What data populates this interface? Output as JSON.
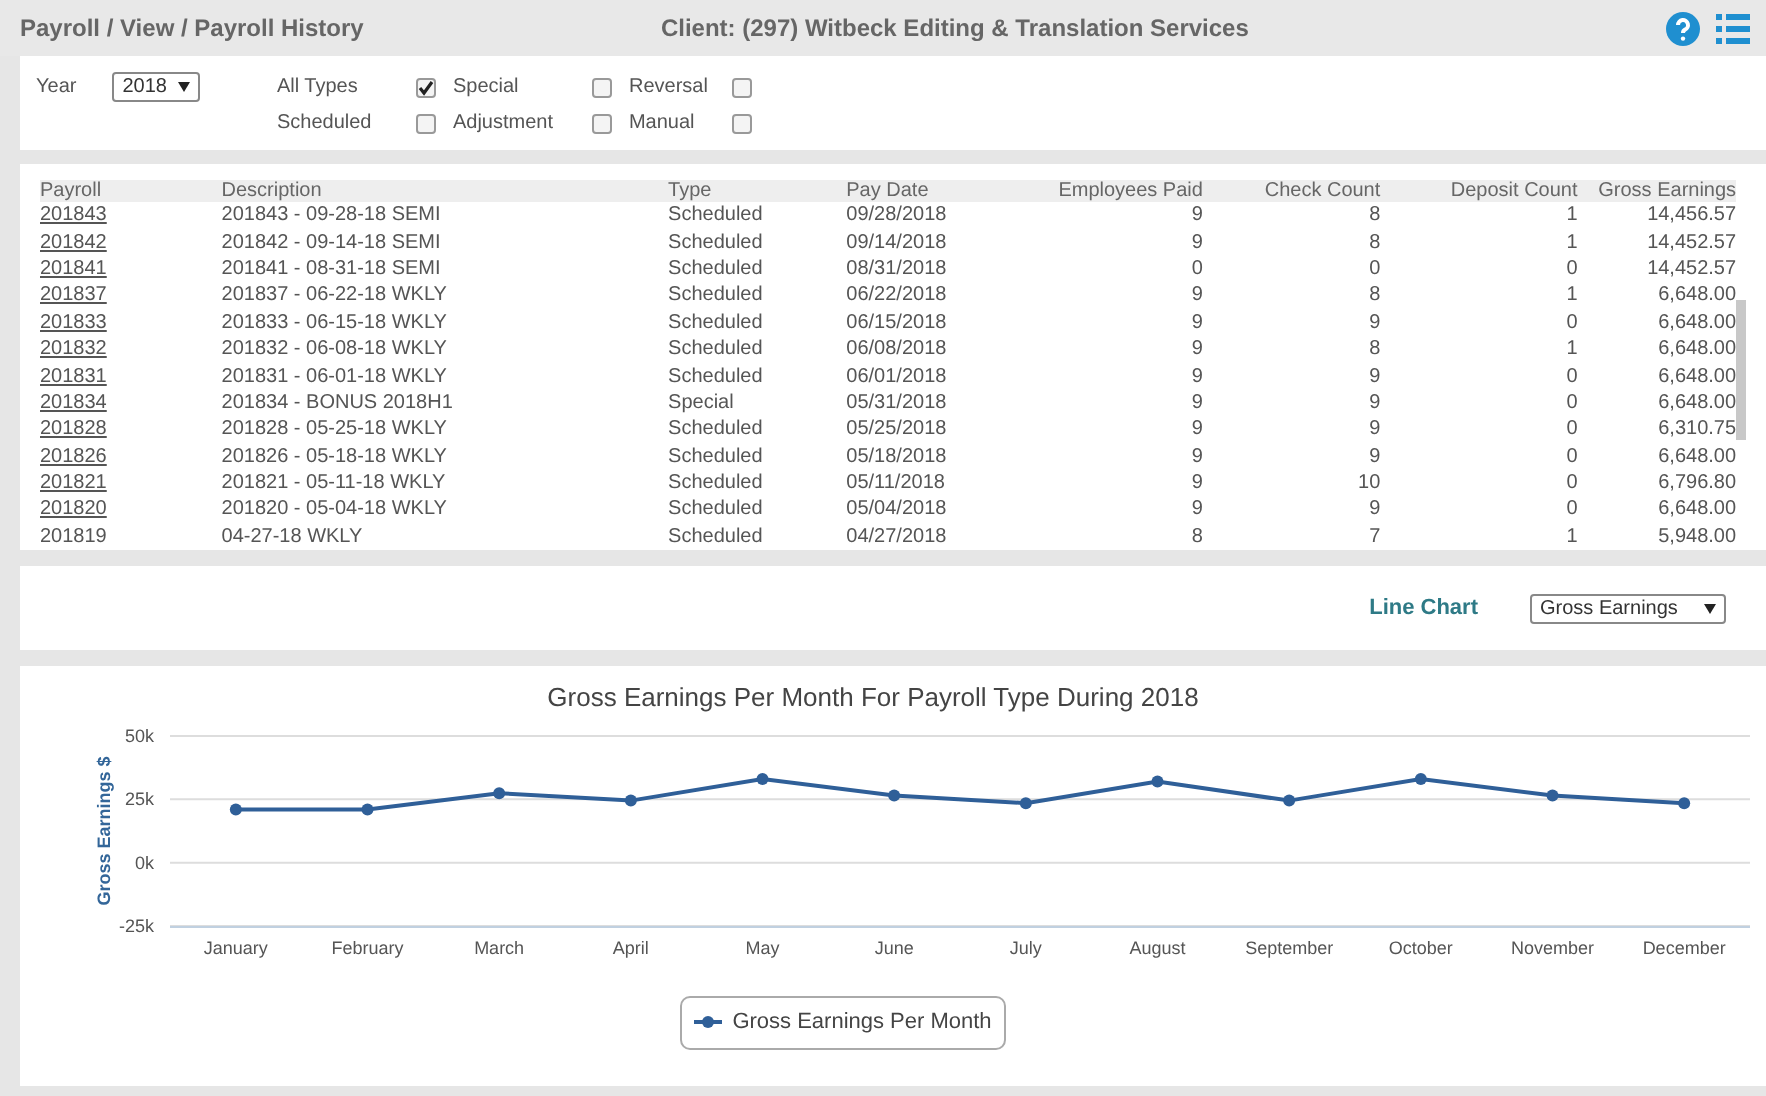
{
  "header": {
    "breadcrumb": "Payroll / View / Payroll History",
    "client": "Client: (297) Witbeck Editing & Translation Services"
  },
  "filters": {
    "year_label": "Year",
    "year": "2018",
    "types": [
      {
        "label": "All Types",
        "checked": true
      },
      {
        "label": "Special",
        "checked": false
      },
      {
        "label": "Reversal",
        "checked": false
      },
      {
        "label": "Scheduled",
        "checked": false
      },
      {
        "label": "Adjustment",
        "checked": false
      },
      {
        "label": "Manual",
        "checked": false
      }
    ]
  },
  "table": {
    "columns": [
      "Payroll",
      "Description",
      "Type",
      "Pay Date",
      "Employees Paid",
      "Check Count",
      "Deposit Count",
      "Gross Earnings"
    ],
    "rows": [
      {
        "link": true,
        "cells": [
          "201843",
          "201843 - 09-28-18 SEMI",
          "Scheduled",
          "09/28/2018",
          "9",
          "8",
          "1",
          "14,456.57"
        ]
      },
      {
        "link": true,
        "cells": [
          "201842",
          "201842 - 09-14-18 SEMI",
          "Scheduled",
          "09/14/2018",
          "9",
          "8",
          "1",
          "14,452.57"
        ]
      },
      {
        "link": true,
        "cells": [
          "201841",
          "201841 - 08-31-18 SEMI",
          "Scheduled",
          "08/31/2018",
          "0",
          "0",
          "0",
          "14,452.57"
        ]
      },
      {
        "link": true,
        "cells": [
          "201837",
          "201837 - 06-22-18 WKLY",
          "Scheduled",
          "06/22/2018",
          "9",
          "8",
          "1",
          "6,648.00"
        ]
      },
      {
        "link": true,
        "cells": [
          "201833",
          "201833 - 06-15-18 WKLY",
          "Scheduled",
          "06/15/2018",
          "9",
          "9",
          "0",
          "6,648.00"
        ]
      },
      {
        "link": true,
        "cells": [
          "201832",
          "201832 - 06-08-18 WKLY",
          "Scheduled",
          "06/08/2018",
          "9",
          "8",
          "1",
          "6,648.00"
        ]
      },
      {
        "link": true,
        "cells": [
          "201831",
          "201831 - 06-01-18 WKLY",
          "Scheduled",
          "06/01/2018",
          "9",
          "9",
          "0",
          "6,648.00"
        ]
      },
      {
        "link": true,
        "cells": [
          "201834",
          "201834 - BONUS 2018H1",
          "Special",
          "05/31/2018",
          "9",
          "9",
          "0",
          "6,648.00"
        ]
      },
      {
        "link": true,
        "cells": [
          "201828",
          "201828 - 05-25-18 WKLY",
          "Scheduled",
          "05/25/2018",
          "9",
          "9",
          "0",
          "6,310.75"
        ]
      },
      {
        "link": true,
        "cells": [
          "201826",
          "201826 - 05-18-18 WKLY",
          "Scheduled",
          "05/18/2018",
          "9",
          "9",
          "0",
          "6,648.00"
        ]
      },
      {
        "link": true,
        "cells": [
          "201821",
          "201821 - 05-11-18 WKLY",
          "Scheduled",
          "05/11/2018",
          "9",
          "10",
          "0",
          "6,796.80"
        ]
      },
      {
        "link": true,
        "cells": [
          "201820",
          "201820 - 05-04-18 WKLY",
          "Scheduled",
          "05/04/2018",
          "9",
          "9",
          "0",
          "6,648.00"
        ]
      },
      {
        "link": false,
        "cells": [
          "201819",
          "04-27-18 WKLY",
          "Scheduled",
          "04/27/2018",
          "8",
          "7",
          "1",
          "5,948.00"
        ]
      }
    ]
  },
  "chart_controls": {
    "chart_type": "Line Chart",
    "measure": "Gross Earnings"
  },
  "chart": {
    "chart_data": {
      "type": "line",
      "title": "Gross Earnings Per Month For Payroll Type During 2018",
      "ylabel": "Gross Earnings $",
      "categories": [
        "January",
        "February",
        "March",
        "April",
        "May",
        "June",
        "July",
        "August",
        "September",
        "October",
        "November",
        "December"
      ],
      "series": [
        {
          "name": "Gross Earnings Per Month",
          "color": "#2f5f98",
          "marker": "circle",
          "values": [
            21000,
            21000,
            27400,
            24500,
            33000,
            26500,
            23500,
            32000,
            24500,
            33000,
            26500,
            23500
          ]
        }
      ],
      "ylim": [
        -25000,
        50000
      ],
      "yticks": [
        {
          "value": -25000,
          "label": "-25k"
        },
        {
          "value": 0,
          "label": "0k"
        },
        {
          "value": 25000,
          "label": "25k"
        },
        {
          "value": 50000,
          "label": "50k"
        }
      ]
    }
  }
}
